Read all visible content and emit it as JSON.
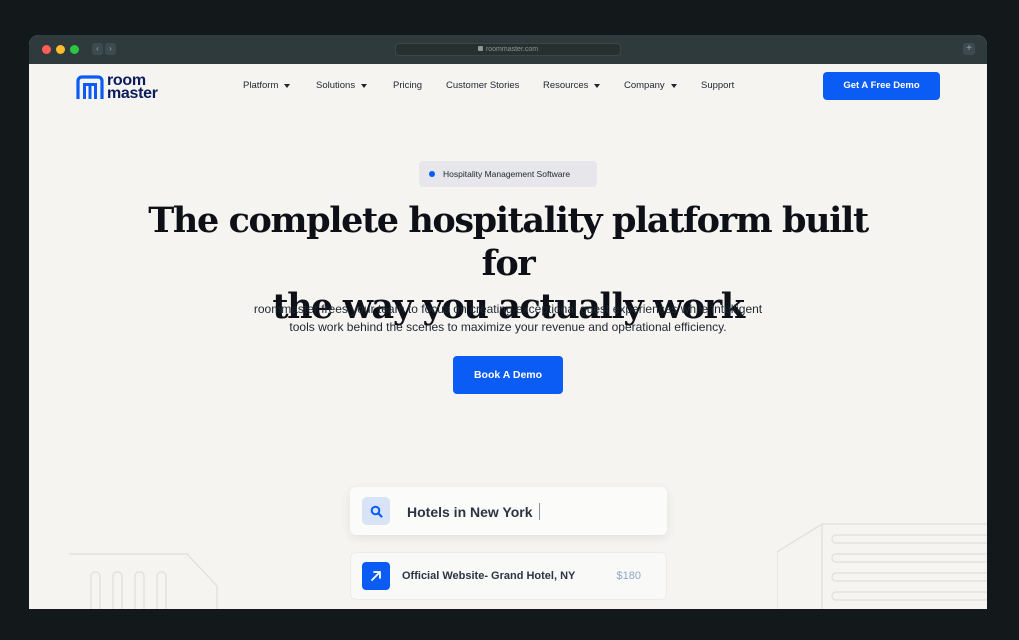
{
  "browser": {
    "url": "roommaster.com"
  },
  "brand": {
    "logo_line1": "room",
    "logo_line2": "master",
    "accent_color": "#0b5cf5",
    "logo_color": "#0b1b5c"
  },
  "nav": {
    "items": [
      {
        "label": "Platform",
        "dropdown": true
      },
      {
        "label": "Solutions",
        "dropdown": true
      },
      {
        "label": "Pricing",
        "dropdown": false
      },
      {
        "label": "Customer Stories",
        "dropdown": false
      },
      {
        "label": "Resources",
        "dropdown": true
      },
      {
        "label": "Company",
        "dropdown": true
      },
      {
        "label": "Support",
        "dropdown": false
      }
    ],
    "cta_label": "Get A Free Demo"
  },
  "hero": {
    "badge": "Hospitality Management Software",
    "headline_line1": "The complete hospitality platform built for",
    "headline_line2": "the way you actually work",
    "subtext_line1": "roommaster frees your team to focus on creating exceptional guest experiences while intelligent",
    "subtext_line2": "tools work behind the scenes to maximize your revenue and operational efficiency.",
    "cta_label": "Book A Demo"
  },
  "search_demo": {
    "query": "Hotels in New York",
    "result_title": "Official Website- Grand Hotel, NY",
    "result_price": "$180"
  }
}
